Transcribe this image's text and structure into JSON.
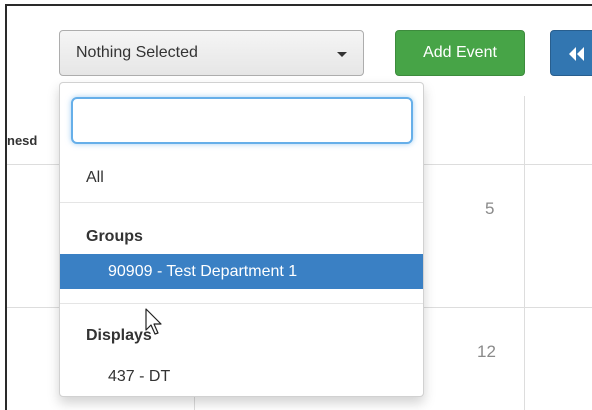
{
  "toolbar": {
    "select_label": "Nothing Selected",
    "add_event_label": "Add Event",
    "prev_icon": "double-chevron-left-icon"
  },
  "calendar": {
    "day_header_partial": "nesd",
    "day_numbers": [
      "5",
      "12"
    ]
  },
  "dropdown": {
    "search_value": "",
    "all_label": "All",
    "groups_header": "Groups",
    "groups": [
      {
        "label": "90909 - Test Department 1",
        "selected": true
      }
    ],
    "displays_header": "Displays",
    "displays": [
      {
        "label": "437 - DT",
        "selected": false
      }
    ]
  },
  "colors": {
    "add_event_bg": "#47a447",
    "nav_button_bg": "#3276b1",
    "selected_item_bg": "#3a80c4",
    "search_focus_border": "#66afe9"
  }
}
